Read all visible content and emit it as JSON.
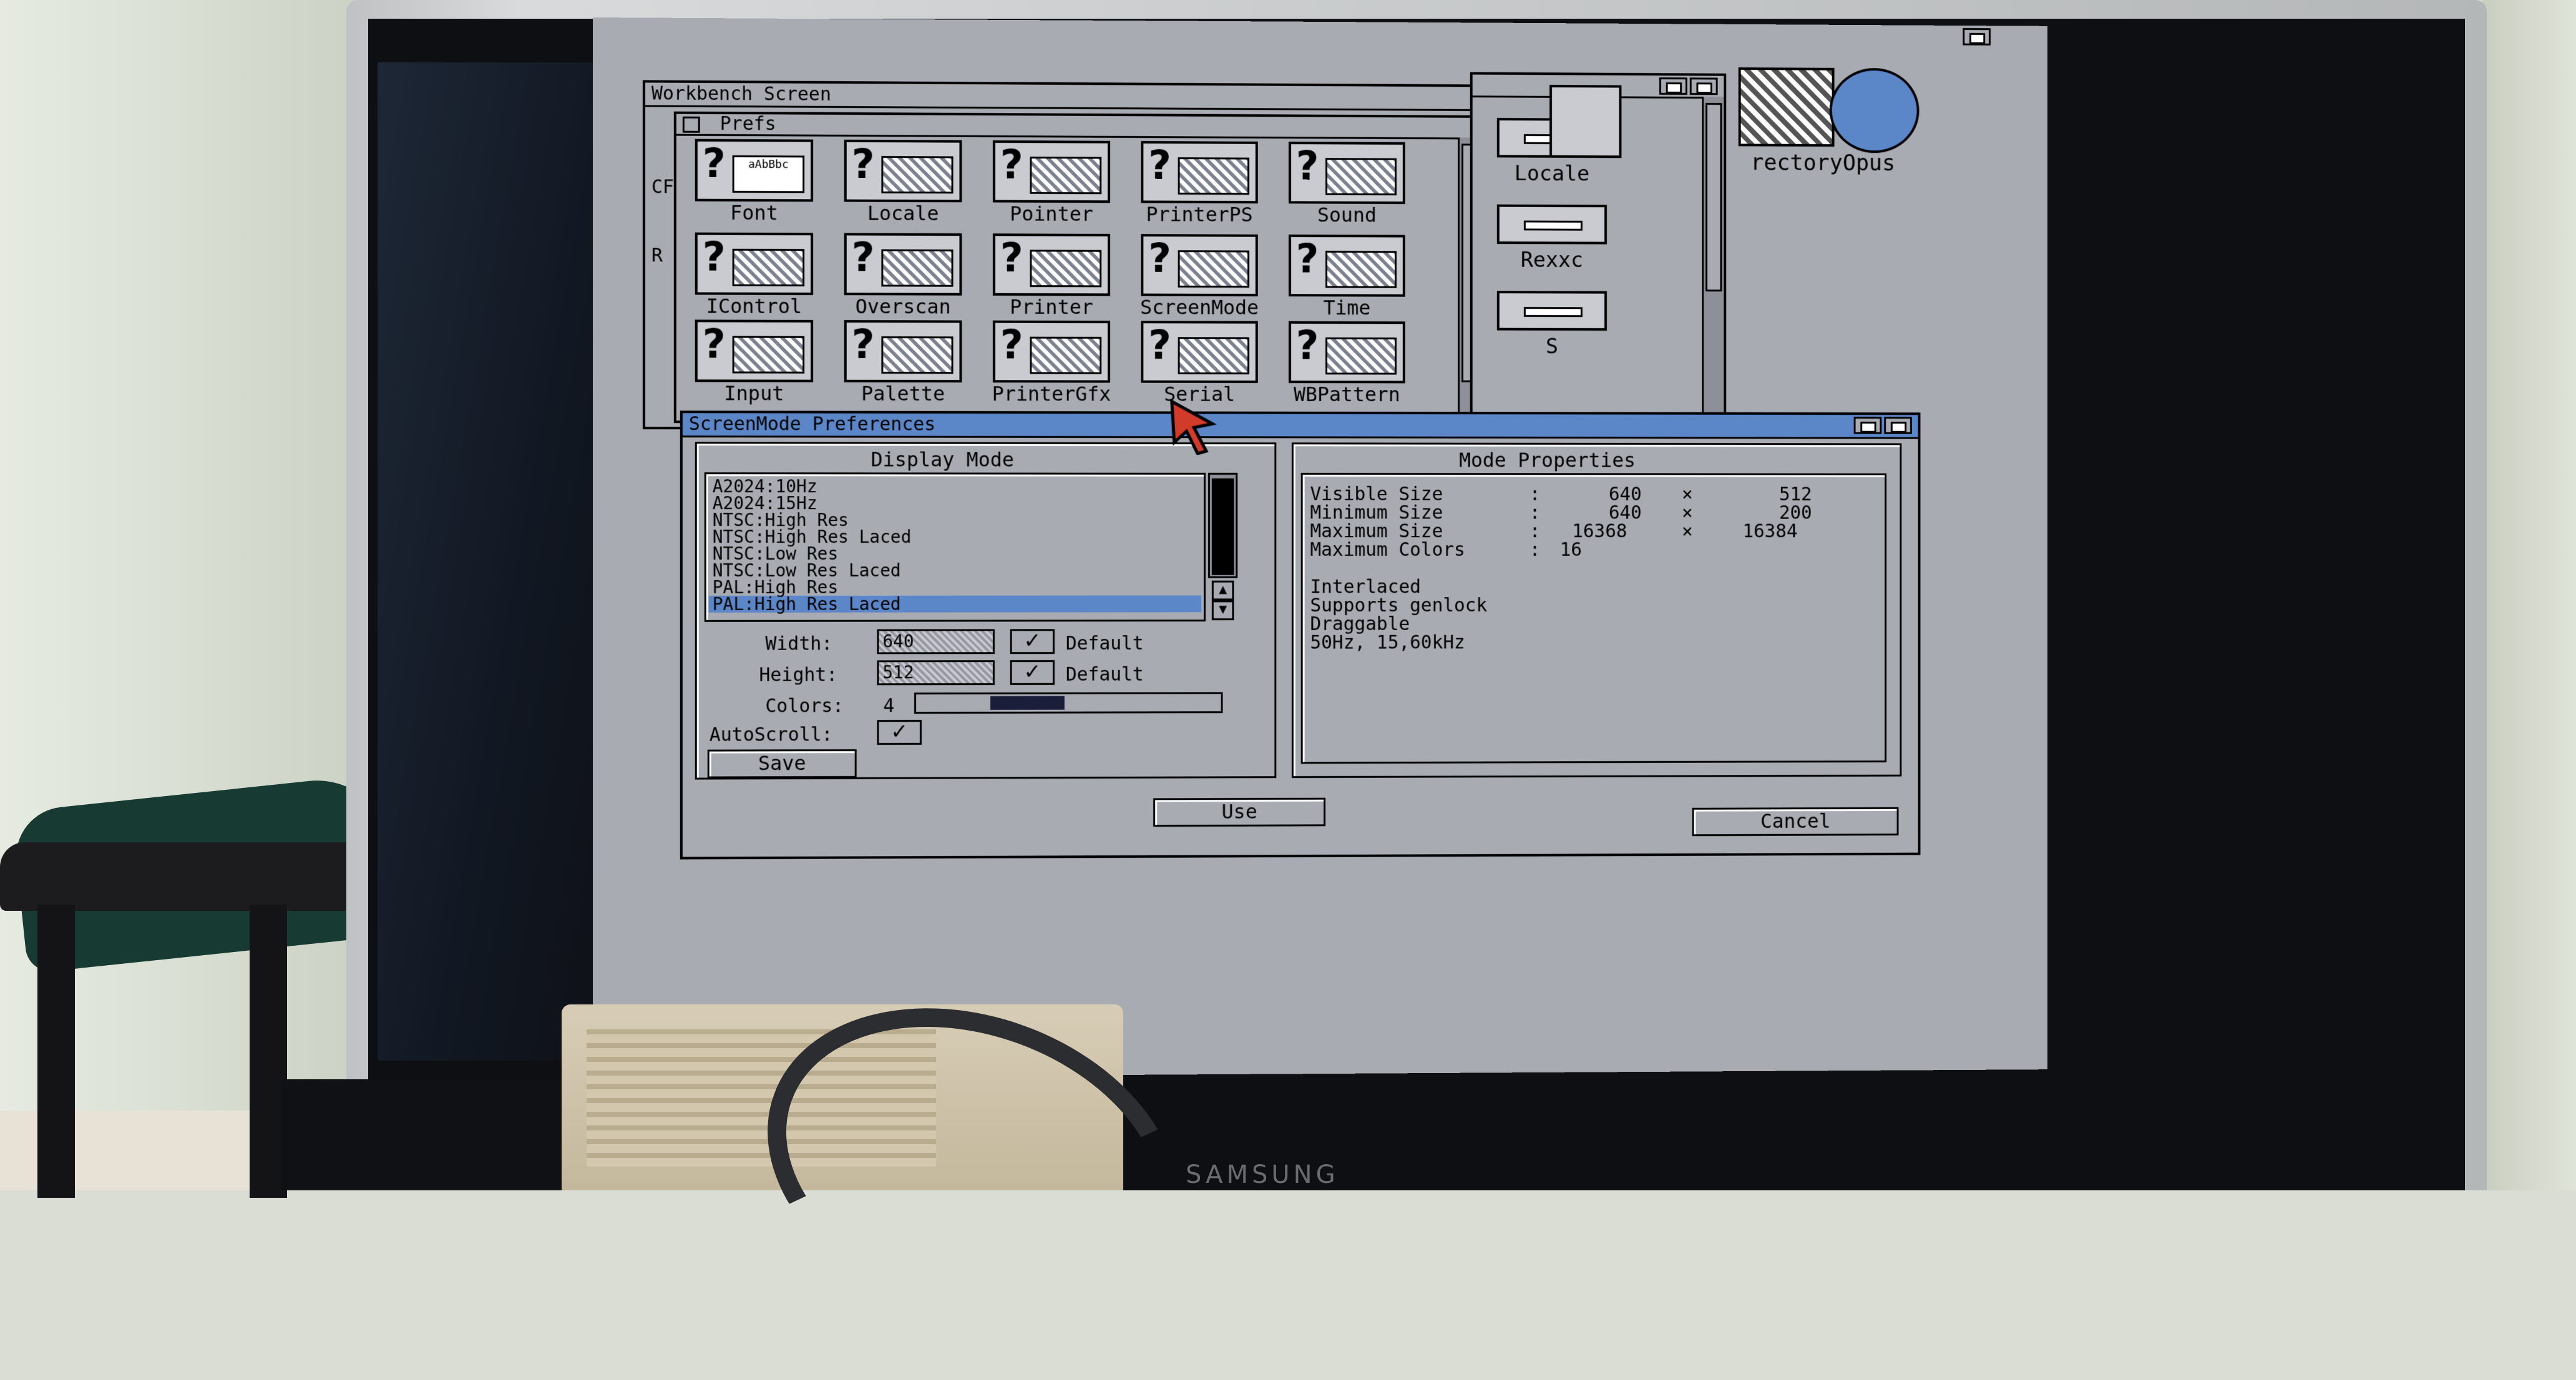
{
  "colors": {
    "workbench_bg": "#a9abb3",
    "active_title": "#5b86c8",
    "selection": "#5b86c8",
    "text": "#000000"
  },
  "workbench": {
    "title": "Workbench Screen",
    "partial_left_labels": [
      "CF",
      "R"
    ]
  },
  "prefs_window": {
    "title": "Prefs",
    "icons": [
      {
        "label": "Font",
        "icon": "font-prefs-icon",
        "art_text": "aAbBbc"
      },
      {
        "label": "Locale",
        "icon": "locale-prefs-icon"
      },
      {
        "label": "Pointer",
        "icon": "pointer-prefs-icon"
      },
      {
        "label": "PrinterPS",
        "icon": "printerps-prefs-icon"
      },
      {
        "label": "Sound",
        "icon": "sound-prefs-icon"
      },
      {
        "label": "IControl",
        "icon": "icontrol-prefs-icon"
      },
      {
        "label": "Overscan",
        "icon": "overscan-prefs-icon"
      },
      {
        "label": "Printer",
        "icon": "printer-prefs-icon"
      },
      {
        "label": "ScreenMode",
        "icon": "screenmode-prefs-icon"
      },
      {
        "label": "Time",
        "icon": "time-prefs-icon"
      },
      {
        "label": "Input",
        "icon": "input-prefs-icon"
      },
      {
        "label": "Palette",
        "icon": "palette-prefs-icon"
      },
      {
        "label": "PrinterGfx",
        "icon": "printergfx-prefs-icon"
      },
      {
        "label": "Serial",
        "icon": "serial-prefs-icon"
      },
      {
        "label": "WBPattern",
        "icon": "wbpattern-prefs-icon"
      }
    ]
  },
  "drawer_window": {
    "drawers": [
      {
        "label": "Locale"
      },
      {
        "label": "Rexxc"
      },
      {
        "label": "S"
      }
    ]
  },
  "desktop_icon": {
    "label": "rectoryOpus"
  },
  "screenmode_window": {
    "title": "ScreenMode Preferences",
    "display_mode_header": "Display Mode",
    "mode_properties_header": "Mode Properties",
    "modes": [
      "A2024:10Hz",
      "A2024:15Hz",
      "NTSC:High Res",
      "NTSC:High Res Laced",
      "NTSC:Low Res",
      "NTSC:Low Res Laced",
      "PAL:High Res",
      "PAL:High Res Laced"
    ],
    "selected_index": 7,
    "width": {
      "label": "Width:",
      "value": "640",
      "default_label": "Default",
      "default_checked": "✓"
    },
    "height": {
      "label": "Height:",
      "value": "512",
      "default_label": "Default",
      "default_checked": "✓"
    },
    "colors": {
      "label": "Colors:",
      "value": "4"
    },
    "autoscroll": {
      "label": "AutoScroll:",
      "checked": "✓"
    },
    "properties": {
      "visible_size": {
        "label": "Visible Size",
        "sep": ":",
        "w": "640",
        "x": "×",
        "h": "512"
      },
      "minimum_size": {
        "label": "Minimum Size",
        "sep": ":",
        "w": "640",
        "x": "×",
        "h": "200"
      },
      "maximum_size": {
        "label": "Maximum Size",
        "sep": ":",
        "w": "16368",
        "x": "×",
        "h": "16384"
      },
      "maximum_colors": {
        "label": "Maximum Colors",
        "sep": ":",
        "value": "16"
      },
      "flags": [
        "Interlaced",
        "Supports genlock",
        "Draggable",
        "50Hz, 15,60kHz"
      ]
    },
    "buttons": {
      "save": "Save",
      "use": "Use",
      "cancel": "Cancel"
    }
  },
  "hardware": {
    "monitor_brand": "SAMSUNG"
  }
}
